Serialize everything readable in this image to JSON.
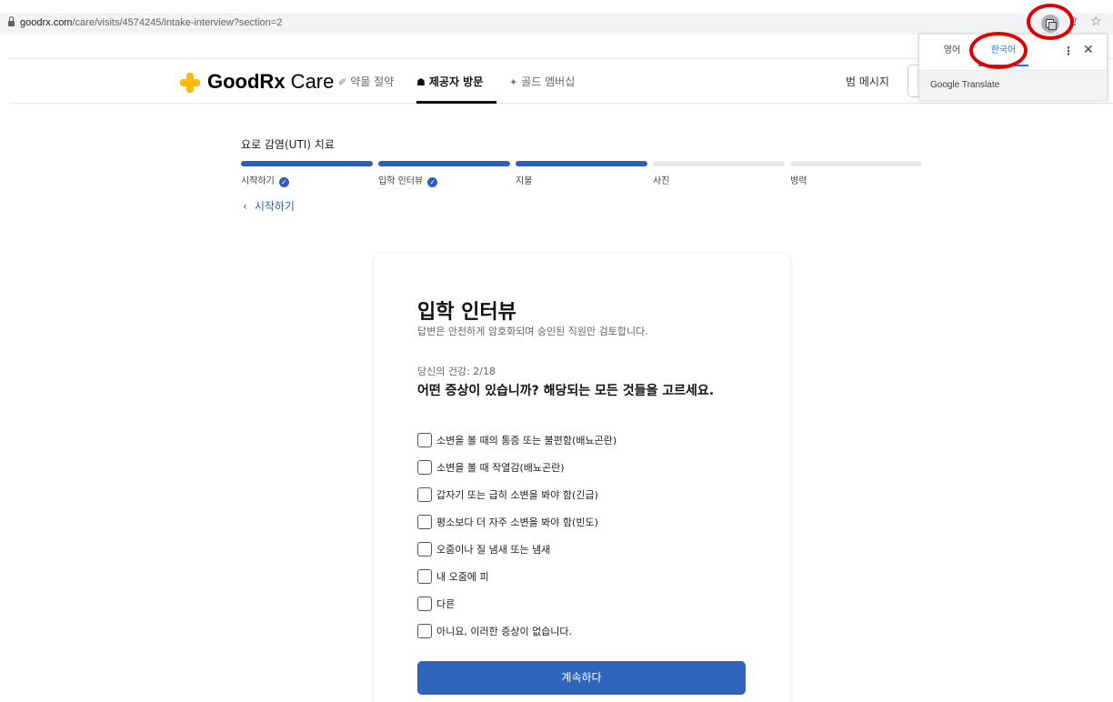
{
  "browser": {
    "url_domain": "goodrx.com",
    "url_path": "/care/visits/4574245/intake-interview?section=2"
  },
  "translate_popup": {
    "tab_source": "영어",
    "tab_target": "한국어",
    "menu_icon": "⋮",
    "close_icon": "✕",
    "footer": "Google Translate"
  },
  "header": {
    "logo_bold": "GoodRx",
    "logo_light": " Care",
    "nav": {
      "rx_savings": "약물 절약",
      "provider_visit": "제공자 방문",
      "gold": "골드 멤버십"
    },
    "messages": "범 메시지"
  },
  "progress": {
    "section_title": "요로 감염(UTI) 치료",
    "steps": [
      {
        "label": "시작하기",
        "state": "done"
      },
      {
        "label": "입학 인터뷰",
        "state": "done"
      },
      {
        "label": "지불",
        "state": "active"
      },
      {
        "label": "사진",
        "state": "pending"
      },
      {
        "label": "병력",
        "state": "pending"
      }
    ],
    "back_label": "시작하기"
  },
  "card": {
    "title": "입학 인터뷰",
    "subtitle": "답변은 안전하게 암호화되며 승인된 직원만 검토합니다.",
    "progress_label": "당신의 건강: 2/18",
    "question": "어떤 증상이 있습니까? 해당되는 모든 것들을 고르세요.",
    "options": [
      "소변을 볼 때의 통증 또는 불편함(배뇨곤란)",
      "소변을 볼 때 작열감(배뇨곤란)",
      "갑자기 또는 급히 소변을 봐야 함(긴급)",
      "평소보다 더 자주 소변을 봐야 함(빈도)",
      "오줌이나 질 냄새 또는 냄새",
      "내 오줌에 피",
      "다른",
      "아니요, 이러한 증상이 없습니다."
    ],
    "continue_label": "계속하다"
  },
  "colors": {
    "brand_blue": "#2e64bc",
    "brand_yellow": "#fdb813",
    "annotation_red": "#e00000"
  }
}
